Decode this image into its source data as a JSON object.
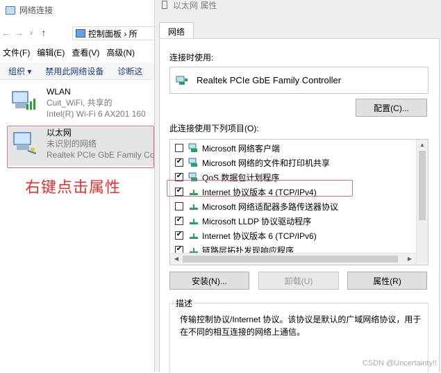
{
  "background_window": {
    "title": "网络连接",
    "address_text": "控制面板 › 所",
    "menu": [
      "文件(F)",
      "编辑(E)",
      "查看(V)",
      "高级(N)"
    ],
    "commands": [
      "组织 ▾",
      "禁用此网络设备",
      "诊断这"
    ],
    "adapters": [
      {
        "name": "WLAN",
        "line2": "Cuit_WiFi, 共享的",
        "line3": "Intel(R) Wi-Fi 6 AX201 160"
      },
      {
        "name": "以太网",
        "line2": "未识别的网络",
        "line3": "Realtek PCIe GbE Family Co"
      }
    ],
    "annotation": "右键点击属性"
  },
  "dialog": {
    "title": "以太网 属性",
    "tab_label": "网络",
    "connect_using_label": "连接时使用:",
    "adapter_name": "Realtek PCIe GbE Family Controller",
    "configure_button": "配置(C)...",
    "items_label": "此连接使用下列项目(O):",
    "items": [
      {
        "label": "Microsoft 网络客户端",
        "checked": false,
        "icon": "network-client-icon"
      },
      {
        "label": "Microsoft 网络的文件和打印机共享",
        "checked": true,
        "icon": "file-share-icon"
      },
      {
        "label": "QoS 数据包计划程序",
        "checked": true,
        "icon": "qos-icon"
      },
      {
        "label": "Internet 协议版本 4 (TCP/IPv4)",
        "checked": true,
        "icon": "protocol-icon"
      },
      {
        "label": "Microsoft 网络适配器多路传送器协议",
        "checked": false,
        "icon": "protocol-icon"
      },
      {
        "label": "Microsoft LLDP 协议驱动程序",
        "checked": true,
        "icon": "protocol-icon"
      },
      {
        "label": "Internet 协议版本 6 (TCP/IPv6)",
        "checked": true,
        "icon": "protocol-icon"
      },
      {
        "label": "链路层拓扑发现响应程序",
        "checked": true,
        "icon": "protocol-icon"
      }
    ],
    "install_button": "安装(N)...",
    "uninstall_button": "卸载(U)",
    "properties_button": "属性(R)",
    "description_legend": "描述",
    "description_text": "传输控制协议/Internet 协议。该协议是默认的广域网络协议，用于在不同的相互连接的网络上通信。"
  },
  "watermark": "CSDN @Uncertainty!!"
}
